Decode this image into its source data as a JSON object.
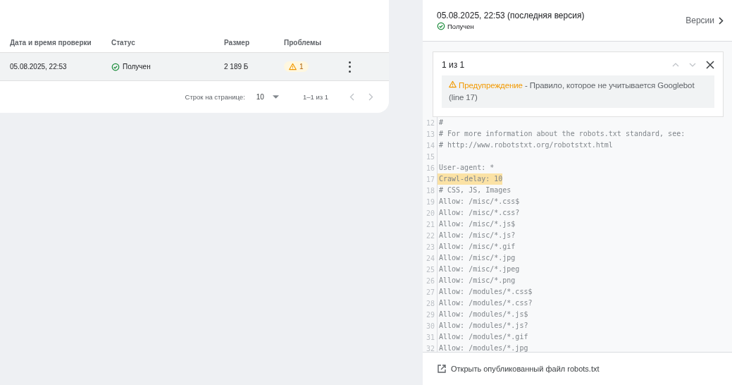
{
  "table": {
    "columns": [
      "Дата и время проверки",
      "Статус",
      "Размер",
      "Проблемы"
    ],
    "rows": [
      {
        "date": "05.08.2025, 22:53",
        "status": "Получен",
        "size": "2 189 Б",
        "issues": "1"
      }
    ],
    "pagination": {
      "rows_per_page_label": "Строк на странице:",
      "rows_per_page": "10",
      "range": "1–1 из 1"
    }
  },
  "panel": {
    "version_title": "05.08.2025, 22:53 (последняя версия)",
    "version_status": "Получен",
    "versions_link": "Версии",
    "issue_nav": {
      "counter": "1 из 1",
      "warning_label": "Предупреждение",
      "warning_text": " - Правило, которое не учитывается Googlebot (line 17)"
    },
    "code_lines": [
      {
        "number": "12",
        "text": "#",
        "highlighted": false
      },
      {
        "number": "13",
        "text": "# For more information about the robots.txt standard, see:",
        "highlighted": false
      },
      {
        "number": "14",
        "text": "# http://www.robotstxt.org/robotstxt.html",
        "highlighted": false
      },
      {
        "number": "15",
        "highlighted": false
      },
      {
        "number": "16",
        "text": "User-agent: *",
        "highlighted": false
      },
      {
        "number": "17",
        "text": "Crawl-delay: 10",
        "highlighted": true
      },
      {
        "number": "18",
        "text": "# CSS, JS, Images",
        "highlighted": false
      },
      {
        "number": "19",
        "text": "Allow: /misc/*.css$",
        "highlighted": false
      },
      {
        "number": "20",
        "text": "Allow: /misc/*.css?",
        "highlighted": false
      },
      {
        "number": "21",
        "text": "Allow: /misc/*.js$",
        "highlighted": false
      },
      {
        "number": "22",
        "text": "Allow: /misc/*.js?",
        "highlighted": false
      },
      {
        "number": "23",
        "text": "Allow: /misc/*.gif",
        "highlighted": false
      },
      {
        "number": "24",
        "text": "Allow: /misc/*.jpg",
        "highlighted": false
      },
      {
        "number": "25",
        "text": "Allow: /misc/*.jpeg",
        "highlighted": false
      },
      {
        "number": "26",
        "text": "Allow: /misc/*.png",
        "highlighted": false
      },
      {
        "number": "27",
        "text": "Allow: /modules/*.css$",
        "highlighted": false
      },
      {
        "number": "28",
        "text": "Allow: /modules/*.css?",
        "highlighted": false
      },
      {
        "number": "29",
        "text": "Allow: /modules/*.js$",
        "highlighted": false
      },
      {
        "number": "30",
        "text": "Allow: /modules/*.js?",
        "highlighted": false
      },
      {
        "number": "31",
        "text": "Allow: /modules/*.gif",
        "highlighted": false
      },
      {
        "number": "32",
        "text": "Allow: /modules/*.jpg",
        "highlighted": false
      }
    ],
    "open_link": "Открыть опубликованный файл robots.txt"
  }
}
